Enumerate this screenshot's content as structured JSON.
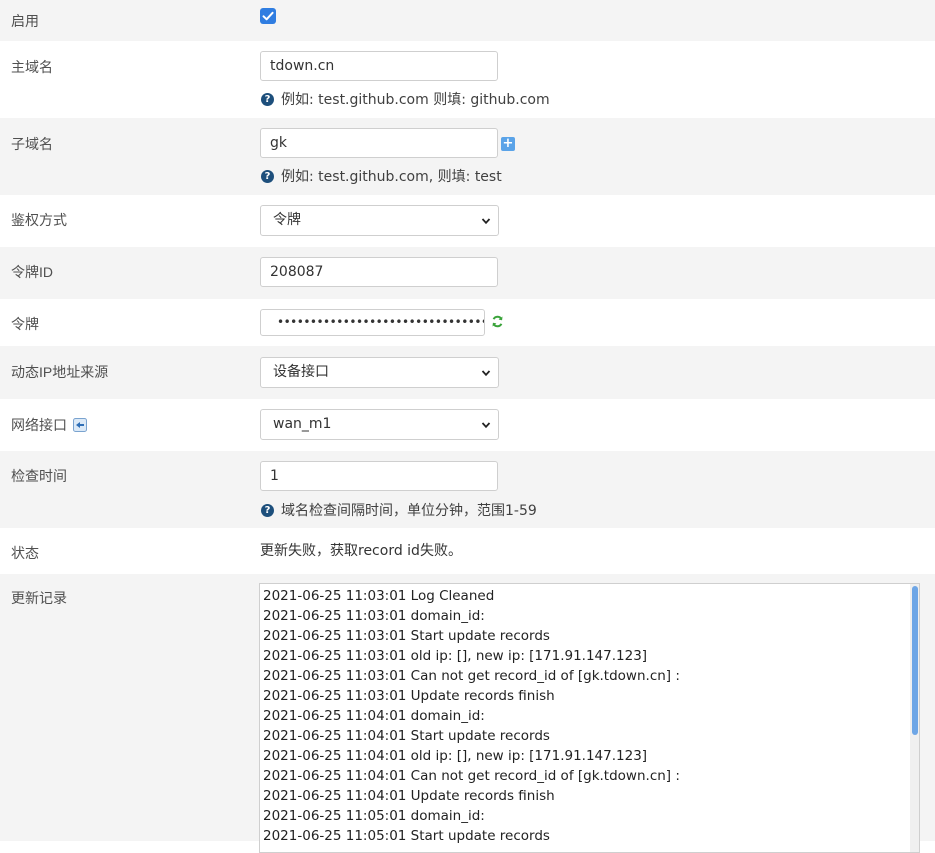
{
  "enable": {
    "label": "启用",
    "checked": true
  },
  "main_domain": {
    "label": "主域名",
    "value": "tdown.cn",
    "hint": "例如: test.github.com 则填: github.com"
  },
  "sub_domain": {
    "label": "子域名",
    "value": "gk",
    "hint": "例如: test.github.com, 则填: test",
    "add_icon": "plus-icon"
  },
  "auth_method": {
    "label": "鉴权方式",
    "value": "令牌"
  },
  "token_id": {
    "label": "令牌ID",
    "value": "208087"
  },
  "token": {
    "label": "令牌",
    "value": "••••••••••••••••••••••••••••••••",
    "reveal_icon": "refresh-icon"
  },
  "ip_source": {
    "label": "动态IP地址来源",
    "value": "设备接口"
  },
  "interface": {
    "label": "网络接口",
    "value": "wan_m1",
    "label_icon": "back-arrow-icon"
  },
  "check_time": {
    "label": "检查时间",
    "value": "1",
    "hint": "域名检查间隔时间，单位分钟，范围1-59"
  },
  "status": {
    "label": "状态",
    "value": "更新失败，获取record id失败。"
  },
  "log": {
    "label": "更新记录",
    "lines": [
      "2021-06-25 11:03:01 Log Cleaned",
      "2021-06-25 11:03:01 domain_id:",
      "2021-06-25 11:03:01 Start update records",
      "2021-06-25 11:03:01 old ip: [], new ip: [171.91.147.123]",
      "2021-06-25 11:03:01 Can not get record_id of [gk.tdown.cn] :",
      "2021-06-25 11:03:01 Update records finish",
      "2021-06-25 11:04:01 domain_id:",
      "2021-06-25 11:04:01 Start update records",
      "2021-06-25 11:04:01 old ip: [], new ip: [171.91.147.123]",
      "2021-06-25 11:04:01 Can not get record_id of [gk.tdown.cn] :",
      "2021-06-25 11:04:01 Update records finish",
      "2021-06-25 11:05:01 domain_id:",
      "2021-06-25 11:05:01 Start update records"
    ]
  },
  "colors": {
    "accent": "#2f7de1",
    "row_gray": "#f4f4f4",
    "help_icon": "#1d4f7c",
    "refresh": "#4caf50"
  }
}
